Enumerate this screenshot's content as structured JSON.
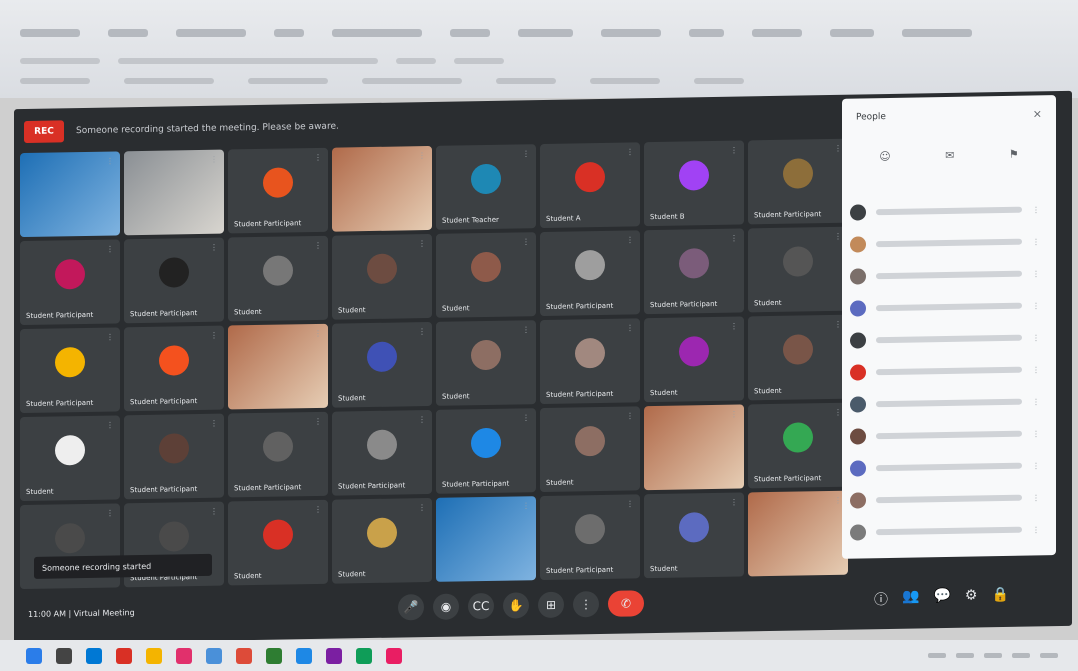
{
  "banner": {
    "rec_label": "REC",
    "text": "Someone recording started the meeting. Please be aware."
  },
  "tiles": [
    {
      "type": "video",
      "tone": "blue",
      "name": ""
    },
    {
      "type": "video",
      "tone": "",
      "name": ""
    },
    {
      "type": "avatar",
      "color": "#e8541e",
      "initial": "",
      "name": "Student Participant"
    },
    {
      "type": "video",
      "tone": "warm",
      "name": ""
    },
    {
      "type": "avatar",
      "color": "#1e88b4",
      "initial": "",
      "name": "Student Teacher"
    },
    {
      "type": "avatar",
      "color": "#d93025",
      "initial": "",
      "name": "Student A"
    },
    {
      "type": "avatar",
      "color": "#a142f4",
      "initial": "",
      "name": "Student B"
    },
    {
      "type": "avatar",
      "color": "#8d6e3a",
      "initial": "",
      "name": "Student Participant"
    },
    {
      "type": "avatar",
      "color": "#c2185b",
      "initial": "",
      "name": "Student Participant"
    },
    {
      "type": "avatar",
      "color": "#222222",
      "initial": "",
      "name": "Student Participant"
    },
    {
      "type": "avatar",
      "color": "#777777",
      "initial": "",
      "name": "Student"
    },
    {
      "type": "avatar",
      "color": "#6d4c41",
      "initial": "",
      "name": "Student"
    },
    {
      "type": "avatar",
      "color": "#8e5a4a",
      "initial": "",
      "name": "Student"
    },
    {
      "type": "avatar",
      "color": "#9e9e9e",
      "initial": "",
      "name": "Student Participant"
    },
    {
      "type": "avatar",
      "color": "#7b5c7a",
      "initial": "",
      "name": "Student Participant"
    },
    {
      "type": "avatar",
      "color": "#555555",
      "initial": "",
      "name": "Student"
    },
    {
      "type": "avatar",
      "color": "#f4b400",
      "initial": "",
      "name": "Student Participant"
    },
    {
      "type": "avatar",
      "color": "#f4511e",
      "initial": "",
      "name": "Student Participant"
    },
    {
      "type": "video",
      "tone": "warm",
      "name": ""
    },
    {
      "type": "avatar",
      "color": "#3f51b5",
      "initial": "",
      "name": "Student"
    },
    {
      "type": "avatar",
      "color": "#8d6e63",
      "initial": "",
      "name": "Student"
    },
    {
      "type": "avatar",
      "color": "#a1887f",
      "initial": "",
      "name": "Student Participant"
    },
    {
      "type": "avatar",
      "color": "#9c27b0",
      "initial": "",
      "name": "Student"
    },
    {
      "type": "avatar",
      "color": "#795548",
      "initial": "",
      "name": "Student"
    },
    {
      "type": "avatar",
      "color": "#eeeeee",
      "initial": "",
      "name": "Student"
    },
    {
      "type": "avatar",
      "color": "#5d4037",
      "initial": "",
      "name": "Student Participant"
    },
    {
      "type": "avatar",
      "color": "#616161",
      "initial": "",
      "name": "Student Participant"
    },
    {
      "type": "avatar",
      "color": "#8a8a8a",
      "initial": "",
      "name": "Student Participant"
    },
    {
      "type": "avatar",
      "color": "#1e88e5",
      "initial": "",
      "name": "Student Participant"
    },
    {
      "type": "avatar",
      "color": "#8d6e63",
      "initial": "",
      "name": "Student"
    },
    {
      "type": "video",
      "tone": "warm",
      "name": ""
    },
    {
      "type": "avatar",
      "color": "#34a853",
      "initial": "",
      "name": "Student Participant"
    },
    {
      "type": "avatar",
      "color": "#4a4a4a",
      "initial": "",
      "name": ""
    },
    {
      "type": "avatar",
      "color": "#4a4a4a",
      "initial": "",
      "name": "Student Participant"
    },
    {
      "type": "avatar",
      "color": "#d93025",
      "initial": "",
      "name": "Student"
    },
    {
      "type": "avatar",
      "color": "#c9a14a",
      "initial": "",
      "name": "Student"
    },
    {
      "type": "video",
      "tone": "blue",
      "name": ""
    },
    {
      "type": "avatar",
      "color": "#6d6d6d",
      "initial": "",
      "name": "Student Participant"
    },
    {
      "type": "avatar",
      "color": "#5c6bc0",
      "initial": "",
      "name": "Student"
    },
    {
      "type": "video",
      "tone": "warm",
      "name": ""
    }
  ],
  "toast": {
    "text": "Someone recording started"
  },
  "meeting": {
    "info": "11:00 AM   |   Virtual Meeting"
  },
  "controls": [
    {
      "name": "mic-button",
      "icon": "🎤"
    },
    {
      "name": "camera-button",
      "icon": "◉"
    },
    {
      "name": "captions-button",
      "icon": "CC"
    },
    {
      "name": "raise-hand-button",
      "icon": "✋"
    },
    {
      "name": "present-button",
      "icon": "⊞"
    },
    {
      "name": "more-options-button",
      "icon": "⋮"
    },
    {
      "name": "leave-call-button",
      "icon": "✆"
    }
  ],
  "right_controls": [
    {
      "name": "info-button",
      "icon": "ⓘ"
    },
    {
      "name": "people-button",
      "icon": "👥"
    },
    {
      "name": "chat-button",
      "icon": "💬"
    },
    {
      "name": "activities-button",
      "icon": "⚙"
    },
    {
      "name": "host-controls-button",
      "icon": "🔒"
    }
  ],
  "panel": {
    "title": "People",
    "close_icon": "×",
    "tabs": [
      "☺",
      "✉",
      "⚑"
    ],
    "participants": [
      {
        "color": "#3c4043"
      },
      {
        "color": "#c28a5a"
      },
      {
        "color": "#7b6f6a"
      },
      {
        "color": "#5c6bc0"
      },
      {
        "color": "#3c4043"
      },
      {
        "color": "#d93025"
      },
      {
        "color": "#4a5a6a"
      },
      {
        "color": "#6d4c41"
      },
      {
        "color": "#5c6bc0"
      },
      {
        "color": "#8d6e63"
      },
      {
        "color": "#7b7b7b"
      }
    ]
  },
  "taskbar": {
    "icons": [
      "#2b7de9",
      "#444444",
      "#0078d4",
      "#d93025",
      "#f4b400",
      "#e1306c",
      "#4a90d9",
      "#dd4b39",
      "#2e7d32",
      "#1e88e5",
      "#7b1fa2",
      "#0f9d58",
      "#e91e63"
    ]
  }
}
